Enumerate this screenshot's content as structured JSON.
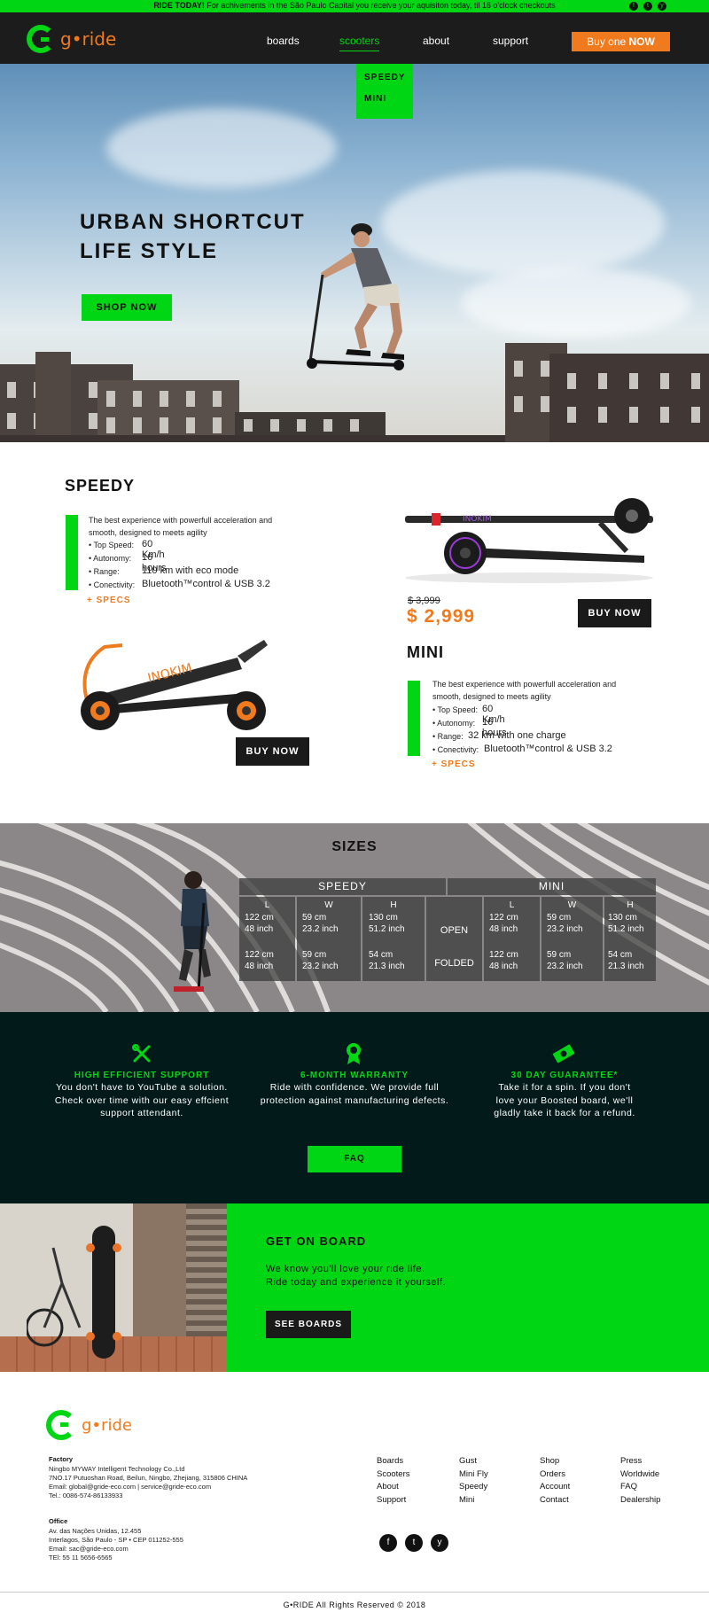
{
  "announcement": {
    "strong": "RIDE TODAY!",
    "text": " For achivements in the São Paulo Capital you receive your aquisiton today, til 16 o'clock checkouts",
    "social": [
      "f",
      "t",
      "y"
    ]
  },
  "brand": {
    "logo_text": "g•ride",
    "accent": "#00d614",
    "orange": "#f07a1e"
  },
  "nav": {
    "items": [
      {
        "label": "boards"
      },
      {
        "label": "scooters"
      },
      {
        "label": "about"
      },
      {
        "label": "support"
      }
    ],
    "buy_prefix": "Buy one ",
    "buy_strong": "NOW",
    "dropdown": [
      "SPEEDY",
      "MINI"
    ]
  },
  "hero": {
    "title_line1": "URBAN SHORTCUT",
    "title_line2": "LIFE STYLE",
    "cta": "SHOP NOW"
  },
  "speedy": {
    "title": "SPEEDY",
    "desc": "The best experience with powerfull acceleration and smooth, designed to meets agility",
    "specs": [
      {
        "label": "• Top Speed:",
        "value": "60 Km/h"
      },
      {
        "label": "• Autonomy:",
        "value": "16 hours"
      },
      {
        "label": "• Range:",
        "value": "110 km with eco mode"
      },
      {
        "label": "• Conectivity:",
        "value": "Bluetooth™control & USB 3.2"
      }
    ],
    "specs_link": "+ SPECS",
    "buy": "BUY NOW"
  },
  "mini": {
    "title": "MINI",
    "old_price": "$ 3,999",
    "price": "$ 2,999",
    "buy": "BUY NOW",
    "desc": "The best experience with powerfull acceleration and smooth, designed to meets agility",
    "specs": [
      {
        "label": "• Top Speed:",
        "value": "60 Km/h"
      },
      {
        "label": "• Autonomy:",
        "value": "16 hours"
      },
      {
        "label": "• Range:",
        "value": "32 km with one charge"
      },
      {
        "label": "• Conectivity:",
        "value": "Bluetooth™control & USB 3.2"
      }
    ],
    "specs_link": "+ SPECS",
    "brand_mark": "INOKIM"
  },
  "sizes": {
    "title": "SIZES",
    "models": [
      "SPEEDY",
      "MINI"
    ],
    "dims": [
      "L",
      "W",
      "H"
    ],
    "rows": [
      "OPEN",
      "FOLDED"
    ],
    "speedy": {
      "open": [
        "122 cm\n48 inch",
        "59 cm\n23.2 inch",
        "130 cm\n51.2 inch"
      ],
      "folded": [
        "122 cm\n48 inch",
        "59 cm\n23.2 inch",
        "54 cm\n21.3 inch"
      ]
    },
    "mini": {
      "open": [
        "122 cm\n48 inch",
        "59 cm\n23.2 inch",
        "130 cm\n51.2 inch"
      ],
      "folded": [
        "122 cm\n48 inch",
        "59 cm\n23.2 inch",
        "54 cm\n21.3 inch"
      ]
    }
  },
  "features": [
    {
      "icon": "tools-icon",
      "title": "HIGH EFFICIENT SUPPORT",
      "body": "You don't have to YouTube a solution. Check over time with our easy effcient support attendant."
    },
    {
      "icon": "award-icon",
      "title": "6-MONTH WARRANTY",
      "body": "Ride with confidence. We provide full protection against manufacturing defects."
    },
    {
      "icon": "money-icon",
      "title": "30 DAY GUARANTEE*",
      "body": "Take it for a spin. If you don't love your Boosted board, we'll gladly take it back for a refund."
    }
  ],
  "faq": "FAQ",
  "get_on_board": {
    "title": "GET ON BOARD",
    "line1": "We know you'll love your ride life.",
    "line2": "Ride today and experience it yourself.",
    "cta": "SEE BOARDS"
  },
  "footer": {
    "factory_label": "Factory",
    "factory_lines": [
      "Ningbo MYWAY Intelligent Technology Co.,Ltd",
      "7NO.17 Putuoshan Road, Beilun, Ningbo, Zhejiang, 315806  CHINA",
      "Email: global@gride-eco.com | service@gride-eco.com",
      "Tel.: 0086-574-86133933"
    ],
    "office_label": "Office",
    "office_lines": [
      "Av. das Nações Unidas, 12.455",
      "Interlagos, São Paulo - SP • CEP 011252-555",
      "Email: sac@gride-eco.com",
      "TEl: 55 11 5656-6565"
    ],
    "columns": [
      [
        "Boards",
        "Scooters",
        "About",
        "Support"
      ],
      [
        "Gust",
        "Mini Fly",
        "Speedy",
        "Mini"
      ],
      [
        "Shop",
        "Orders",
        "Account",
        "Contact"
      ],
      [
        "Press",
        "Worldwide",
        "FAQ",
        "Dealership"
      ]
    ],
    "social": [
      "f",
      "t",
      "y"
    ],
    "copyright": "G•RIDE All Rights Reserved © 2018"
  }
}
